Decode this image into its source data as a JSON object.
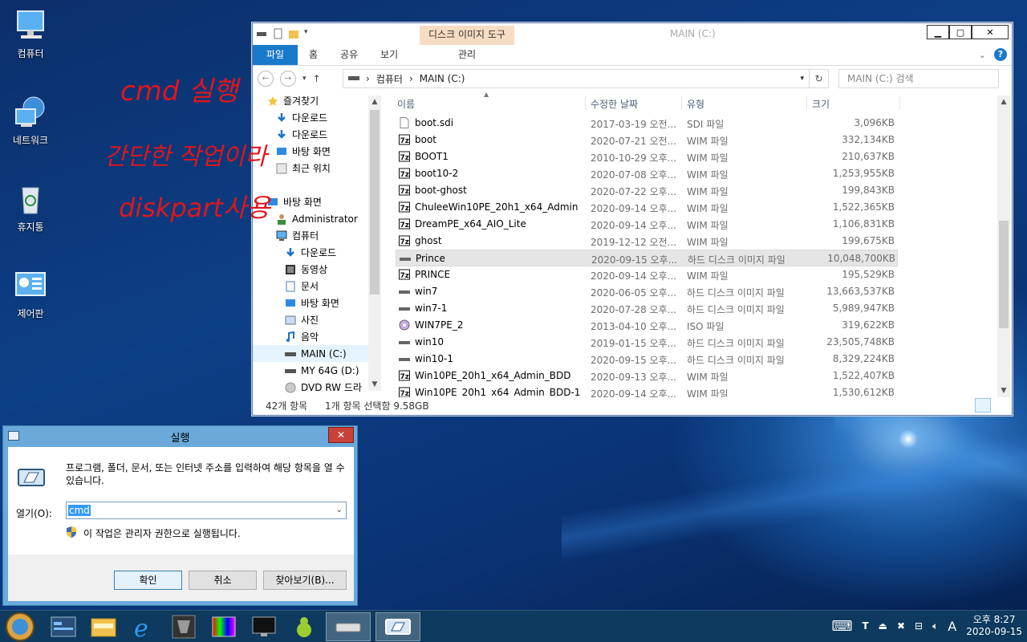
{
  "desktop": {
    "icons": [
      {
        "label": "컴퓨터",
        "icon": "computer-icon"
      },
      {
        "label": "네트워크",
        "icon": "network-icon"
      },
      {
        "label": "휴지통",
        "icon": "recycle-bin-icon"
      },
      {
        "label": "제어판",
        "icon": "control-panel-icon"
      }
    ]
  },
  "explorer": {
    "window_title": "MAIN (C:)",
    "context_tab_title": "디스크 이미지 도구",
    "ribbon_tabs": [
      "파일",
      "홈",
      "공유",
      "보기"
    ],
    "context_tab": "관리",
    "address": {
      "segments": [
        "컴퓨터",
        "MAIN (C:)"
      ]
    },
    "search_placeholder": "MAIN (C:) 검색",
    "nav": [
      {
        "label": "즐겨찾기",
        "icon": "star-icon",
        "indent": 0
      },
      {
        "label": "다운로드",
        "icon": "download-icon",
        "indent": 1
      },
      {
        "label": "다운로드",
        "icon": "download-icon",
        "indent": 1
      },
      {
        "label": "바탕 화면",
        "icon": "desktop-icon",
        "indent": 1
      },
      {
        "label": "최근 위치",
        "icon": "recent-icon",
        "indent": 1
      },
      {
        "label": "",
        "icon": "",
        "indent": 0
      },
      {
        "label": "바탕 화면",
        "icon": "desktop-icon",
        "indent": 0
      },
      {
        "label": "Administrator",
        "icon": "user-icon",
        "indent": 1
      },
      {
        "label": "컴퓨터",
        "icon": "computer-icon",
        "indent": 1
      },
      {
        "label": "다운로드",
        "icon": "download-icon",
        "indent": 2
      },
      {
        "label": "동영상",
        "icon": "video-icon",
        "indent": 2
      },
      {
        "label": "문서",
        "icon": "document-icon",
        "indent": 2
      },
      {
        "label": "바탕 화면",
        "icon": "desktop-icon",
        "indent": 2
      },
      {
        "label": "사진",
        "icon": "picture-icon",
        "indent": 2
      },
      {
        "label": "음악",
        "icon": "music-icon",
        "indent": 2
      },
      {
        "label": "MAIN (C:)",
        "icon": "drive-icon",
        "indent": 2,
        "selected": true
      },
      {
        "label": "MY 64G (D:)",
        "icon": "drive-icon",
        "indent": 2
      },
      {
        "label": "DVD RW 드라",
        "icon": "dvd-icon",
        "indent": 2
      }
    ],
    "columns": [
      "이름",
      "수정한 날짜",
      "유형",
      "크기"
    ],
    "files": [
      {
        "name": "boot.sdi",
        "date": "2017-03-19 오전...",
        "type": "SDI 파일",
        "size": "3,096KB",
        "icon": "file-icon"
      },
      {
        "name": "boot",
        "date": "2020-07-21 오전...",
        "type": "WIM 파일",
        "size": "332,134KB",
        "icon": "7z-icon"
      },
      {
        "name": "BOOT1",
        "date": "2010-10-29 오후...",
        "type": "WIM 파일",
        "size": "210,637KB",
        "icon": "7z-icon"
      },
      {
        "name": "boot10-2",
        "date": "2020-07-08 오후...",
        "type": "WIM 파일",
        "size": "1,253,955KB",
        "icon": "7z-icon"
      },
      {
        "name": "boot-ghost",
        "date": "2020-07-22 오후...",
        "type": "WIM 파일",
        "size": "199,843KB",
        "icon": "7z-icon"
      },
      {
        "name": "ChuleeWin10PE_20h1_x64_Admin",
        "date": "2020-09-14 오후...",
        "type": "WIM 파일",
        "size": "1,522,365KB",
        "icon": "7z-icon"
      },
      {
        "name": "DreamPE_x64_AIO_Lite",
        "date": "2020-09-14 오후...",
        "type": "WIM 파일",
        "size": "1,106,831KB",
        "icon": "7z-icon"
      },
      {
        "name": "ghost",
        "date": "2019-12-12 오전...",
        "type": "WIM 파일",
        "size": "199,675KB",
        "icon": "7z-icon"
      },
      {
        "name": "Prince",
        "date": "2020-09-15 오후...",
        "type": "하드 디스크 이미지 파일",
        "size": "10,048,700KB",
        "icon": "disk-image-icon",
        "selected": true
      },
      {
        "name": "PRINCE",
        "date": "2020-09-14 오후...",
        "type": "WIM 파일",
        "size": "195,529KB",
        "icon": "7z-icon"
      },
      {
        "name": "win7",
        "date": "2020-06-05 오후...",
        "type": "하드 디스크 이미지 파일",
        "size": "13,663,537KB",
        "icon": "disk-image-icon"
      },
      {
        "name": "win7-1",
        "date": "2020-07-28 오후...",
        "type": "하드 디스크 이미지 파일",
        "size": "5,989,947KB",
        "icon": "disk-image-icon"
      },
      {
        "name": "WIN7PE_2",
        "date": "2013-04-10 오후...",
        "type": "ISO 파일",
        "size": "319,622KB",
        "icon": "iso-icon"
      },
      {
        "name": "win10",
        "date": "2019-01-15 오후...",
        "type": "하드 디스크 이미지 파일",
        "size": "23,505,748KB",
        "icon": "disk-image-icon"
      },
      {
        "name": "win10-1",
        "date": "2020-09-15 오후...",
        "type": "하드 디스크 이미지 파일",
        "size": "8,329,224KB",
        "icon": "disk-image-icon"
      },
      {
        "name": "Win10PE_20h1_x64_Admin_BDD",
        "date": "2020-09-13 오후...",
        "type": "WIM 파일",
        "size": "1,522,407KB",
        "icon": "7z-icon"
      },
      {
        "name": "Win10PE_20h1_x64_Admin_BDD-1",
        "date": "2020-09-14 오후...",
        "type": "WIM 파일",
        "size": "1,530,612KB",
        "icon": "7z-icon"
      }
    ],
    "status": {
      "count": "42개 항목",
      "selection": "1개 항목 선택함 9.58GB"
    }
  },
  "run_dialog": {
    "title": "실행",
    "description": "프로그램, 폴더, 문서, 또는 인터넷 주소를 입력하여 해당 항목을 열 수 있습니다.",
    "open_label": "열기(O):",
    "input_value": "cmd",
    "admin_note": "이 작업은 관리자 권한으로 실행됩니다.",
    "buttons": {
      "ok": "확인",
      "cancel": "취소",
      "browse": "찾아보기(B)..."
    }
  },
  "annotation": {
    "line1": "cmd 실행",
    "line2": "간단한 작업이라",
    "line3": "diskpart사용",
    "color": "#e0151d"
  },
  "taskbar": {
    "clock_time": "오후 8:27",
    "clock_date": "2020-09-15",
    "ime": "A"
  },
  "colors": {
    "file_tab": "#1979ca",
    "context_tab": "#f7dcc4",
    "taskbar": "#0d3a5e",
    "selection": "#3399ff"
  }
}
